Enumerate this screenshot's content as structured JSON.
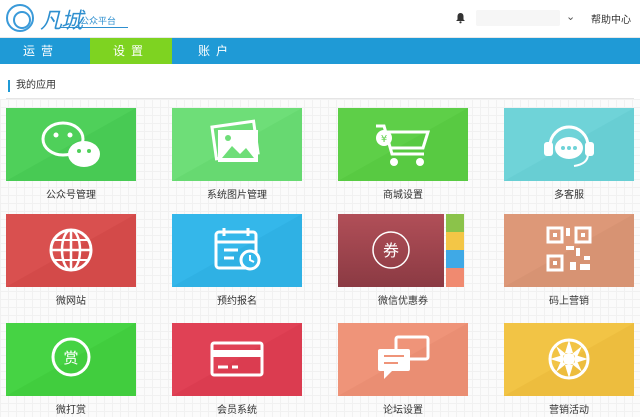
{
  "header": {
    "logo_text": "凡城",
    "logo_sub": "公众平台",
    "help_label": "帮助中心",
    "bell_icon": "bell-icon",
    "dropdown_icon": "chevron-down-icon"
  },
  "nav": {
    "tabs": [
      {
        "label": "运营",
        "active": false
      },
      {
        "label": "设置",
        "active": true
      },
      {
        "label": "账户",
        "active": false
      }
    ]
  },
  "section": {
    "title": "我的应用"
  },
  "apps": [
    {
      "label": "公众号管理",
      "icon": "wechat-icon",
      "color": "#4cd05a"
    },
    {
      "label": "系统图片管理",
      "icon": "picture-icon",
      "color": "#71e07a"
    },
    {
      "label": "商城设置",
      "icon": "cart-icon",
      "color": "#5ed048"
    },
    {
      "label": "多客服",
      "icon": "headset-icon",
      "color": "#6fd3d8"
    },
    {
      "label": "微网站",
      "icon": "globe-icon",
      "color": "#d9504f"
    },
    {
      "label": "预约报名",
      "icon": "calendar-icon",
      "color": "#34b7ea"
    },
    {
      "label": "微信优惠券",
      "icon": "coupon-icon",
      "color": "#a84953"
    },
    {
      "label": "码上营销",
      "icon": "qrcode-icon",
      "color": "#dd9878"
    },
    {
      "label": "微打赏",
      "icon": "reward-icon",
      "color": "#46d344"
    },
    {
      "label": "会员系统",
      "icon": "card-icon",
      "color": "#e04155"
    },
    {
      "label": "论坛设置",
      "icon": "chat-icon",
      "color": "#ef9479"
    },
    {
      "label": "营销活动",
      "icon": "wheel-icon",
      "color": "#f2c445"
    }
  ],
  "coupon_tab_colors": [
    "#8bc34a",
    "#f3c646",
    "#3fa9e6",
    "#f08a70"
  ]
}
